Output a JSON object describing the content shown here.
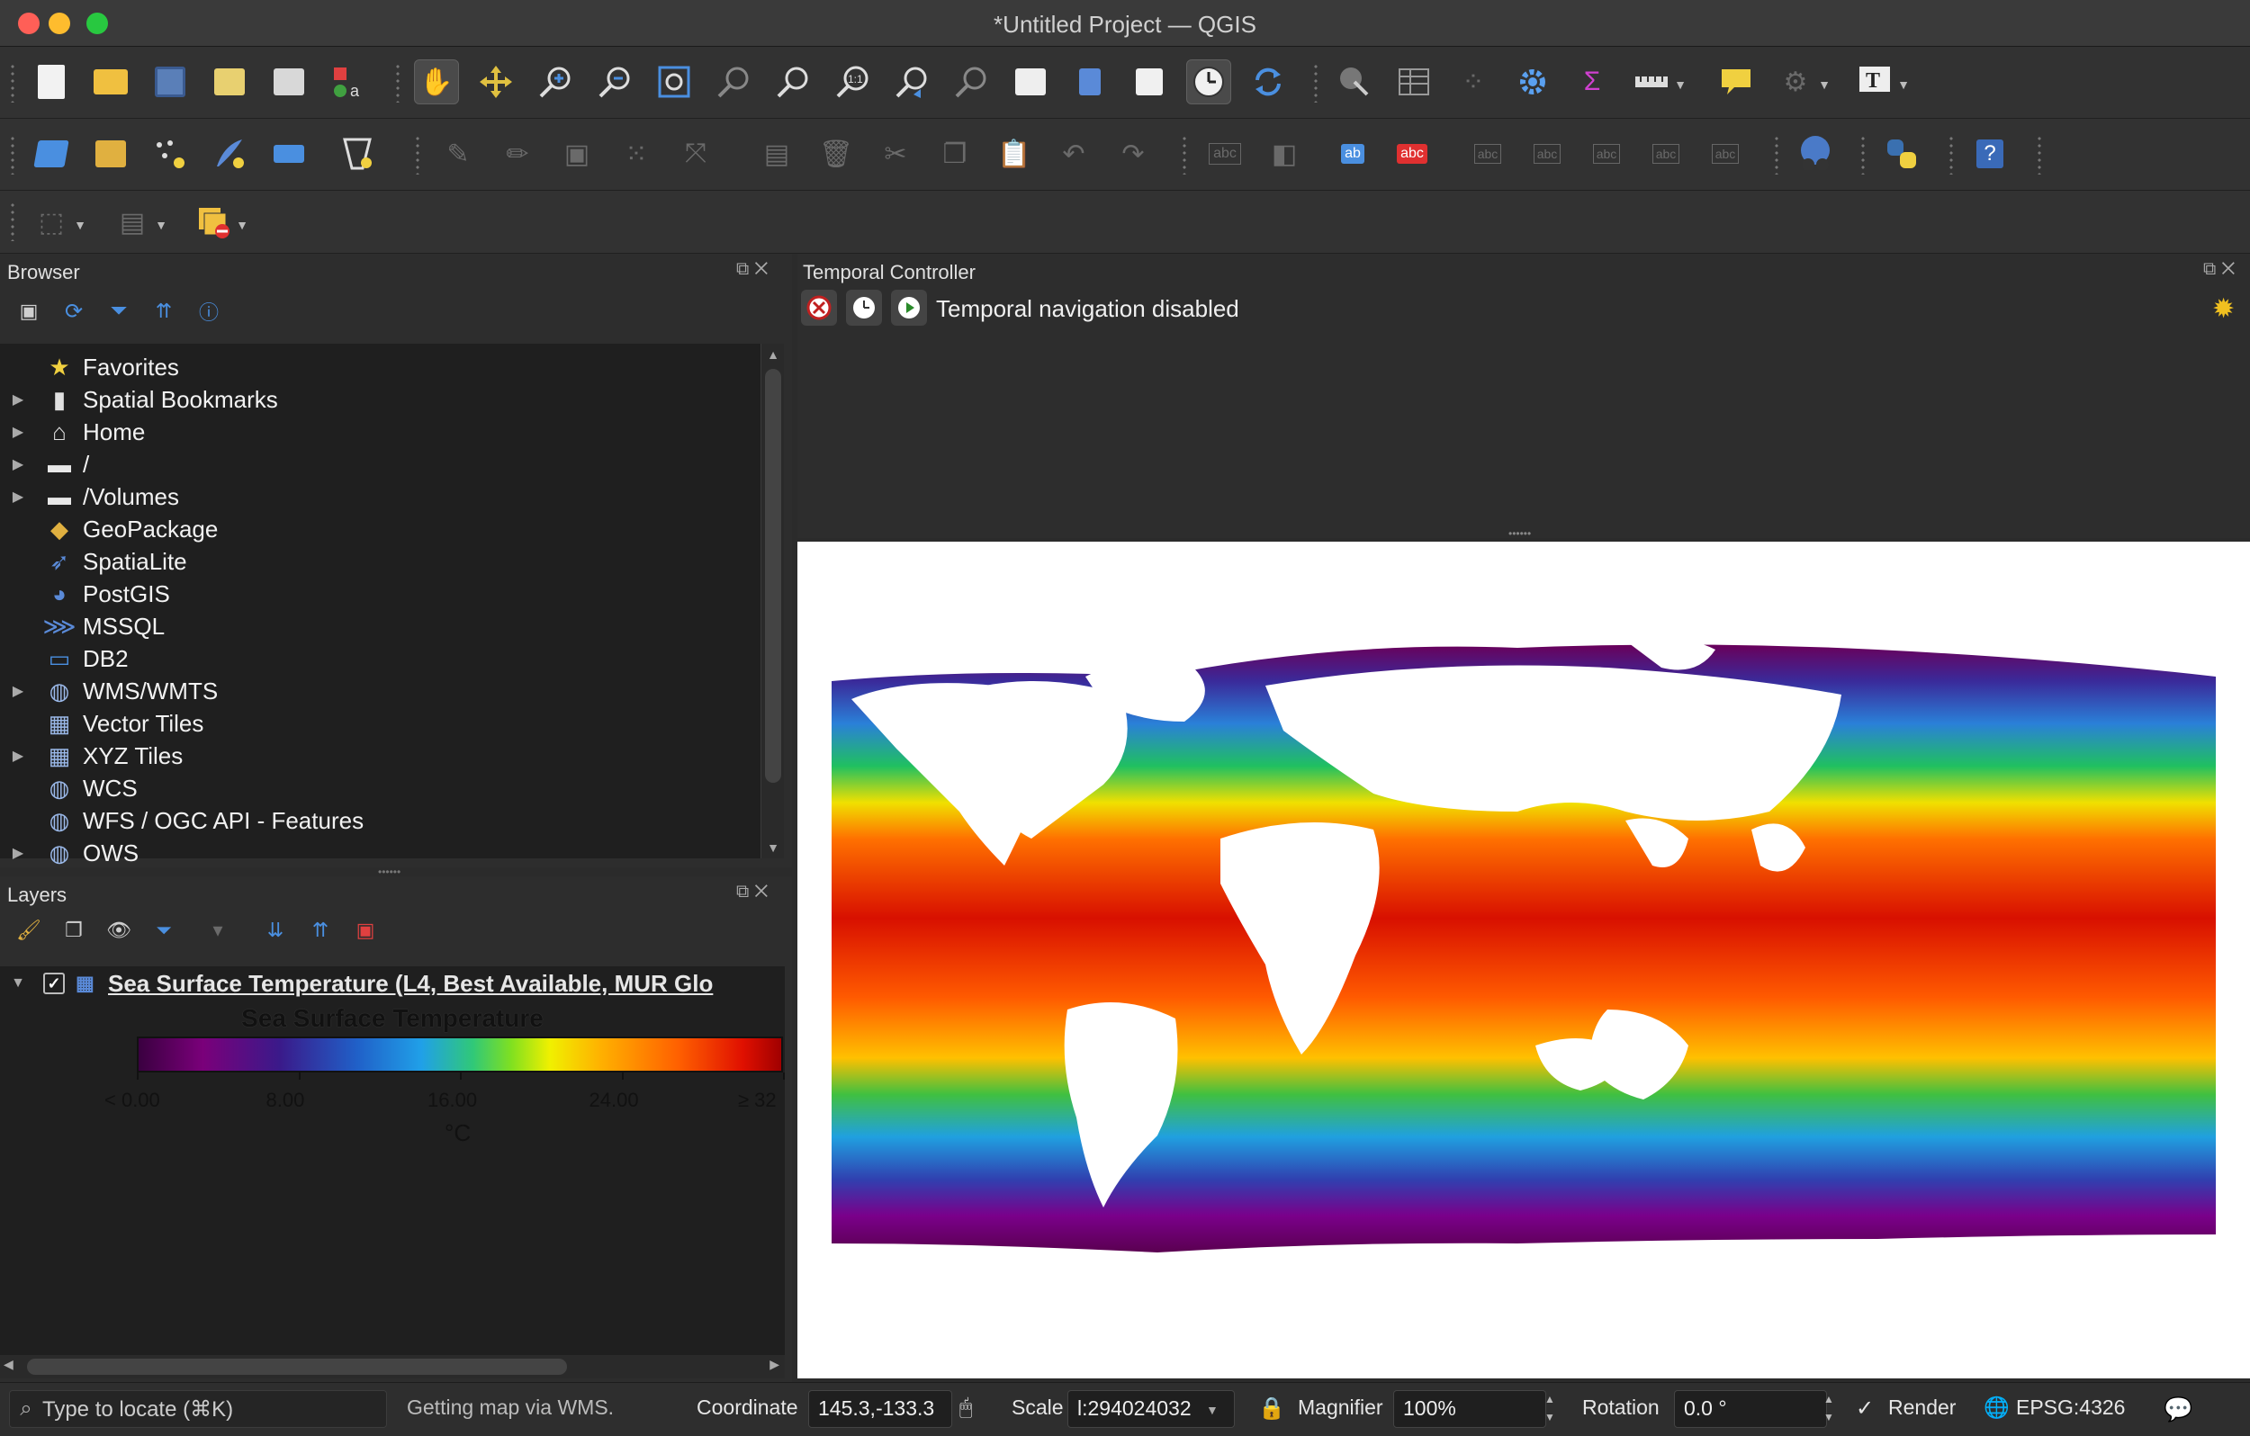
{
  "window": {
    "title": "*Untitled Project — QGIS"
  },
  "browser": {
    "title": "Browser",
    "items": [
      {
        "label": "Favorites",
        "icon": "star-icon",
        "expandable": false
      },
      {
        "label": "Spatial Bookmarks",
        "icon": "bookmark-icon",
        "expandable": true
      },
      {
        "label": "Home",
        "icon": "home-icon",
        "expandable": true
      },
      {
        "label": "/",
        "icon": "folder-icon",
        "expandable": true
      },
      {
        "label": "/Volumes",
        "icon": "folder-icon",
        "expandable": true
      },
      {
        "label": "GeoPackage",
        "icon": "geopackage-icon",
        "expandable": false
      },
      {
        "label": "SpatiaLite",
        "icon": "spatialite-feather-icon",
        "expandable": false
      },
      {
        "label": "PostGIS",
        "icon": "postgis-elephant-icon",
        "expandable": false
      },
      {
        "label": "MSSQL",
        "icon": "mssql-icon",
        "expandable": false
      },
      {
        "label": "DB2",
        "icon": "db2-icon",
        "expandable": false
      },
      {
        "label": "WMS/WMTS",
        "icon": "globe-icon",
        "expandable": true
      },
      {
        "label": "Vector Tiles",
        "icon": "grid-icon",
        "expandable": false
      },
      {
        "label": "XYZ Tiles",
        "icon": "grid-icon",
        "expandable": true
      },
      {
        "label": "WCS",
        "icon": "globe-icon",
        "expandable": false
      },
      {
        "label": "WFS / OGC API - Features",
        "icon": "globe-icon",
        "expandable": false
      },
      {
        "label": "OWS",
        "icon": "globe-icon",
        "expandable": true
      }
    ]
  },
  "layers": {
    "title": "Layers",
    "layer_name": "Sea Surface Temperature (L4, Best Available, MUR Glo",
    "visible": true,
    "legend": {
      "title": "Sea Surface Temperature",
      "labels": [
        "< 0.00",
        "8.00",
        "16.00",
        "24.00",
        "≥ 32"
      ],
      "unit": "°C"
    }
  },
  "temporal": {
    "title": "Temporal Controller",
    "status": "Temporal navigation disabled"
  },
  "statusbar": {
    "locate_placeholder": "Type to locate (⌘K)",
    "message": "Getting map via WMS.",
    "coordinate_label": "Coordinate",
    "coordinate_value": "145.3,-133.3",
    "scale_label": "Scale",
    "scale_value": "l:294024032",
    "magnifier_label": "Magnifier",
    "magnifier_value": "100%",
    "rotation_label": "Rotation",
    "rotation_value": "0.0 °",
    "render_label": "Render",
    "render_checked": true,
    "crs": "EPSG:4326"
  },
  "colors": {
    "background": "#2b2b2b",
    "panel": "#1f1f1f",
    "map_background": "#ffffff",
    "sst_cold": "#7a007a",
    "sst_warm": "#e01000"
  }
}
